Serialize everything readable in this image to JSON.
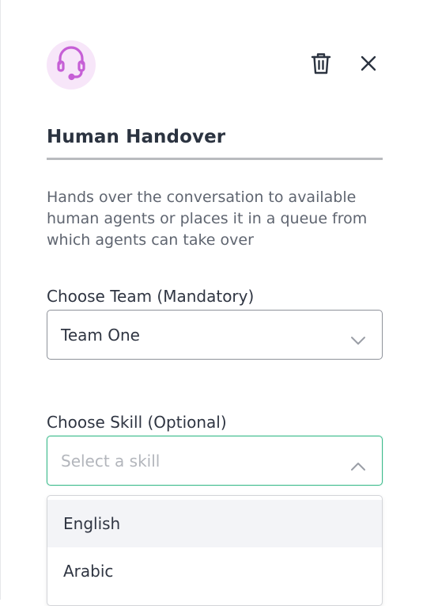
{
  "header": {
    "avatar_icon": "headset-icon",
    "delete_icon": "trash-icon",
    "close_icon": "close-icon"
  },
  "node": {
    "title": "Human Handover",
    "description": "Hands over the conversation to available human agents or places it in a queue from which agents can take over"
  },
  "team_field": {
    "label": "Choose Team (Mandatory)",
    "value": "Team One"
  },
  "skill_field": {
    "label": "Choose Skill (Optional)",
    "placeholder": "Select a skill",
    "options": [
      "English",
      "Arabic"
    ]
  },
  "colors": {
    "accent": "#3dbb8c",
    "avatar_bg": "#f7e6f9",
    "headset": "#c65fd6"
  }
}
